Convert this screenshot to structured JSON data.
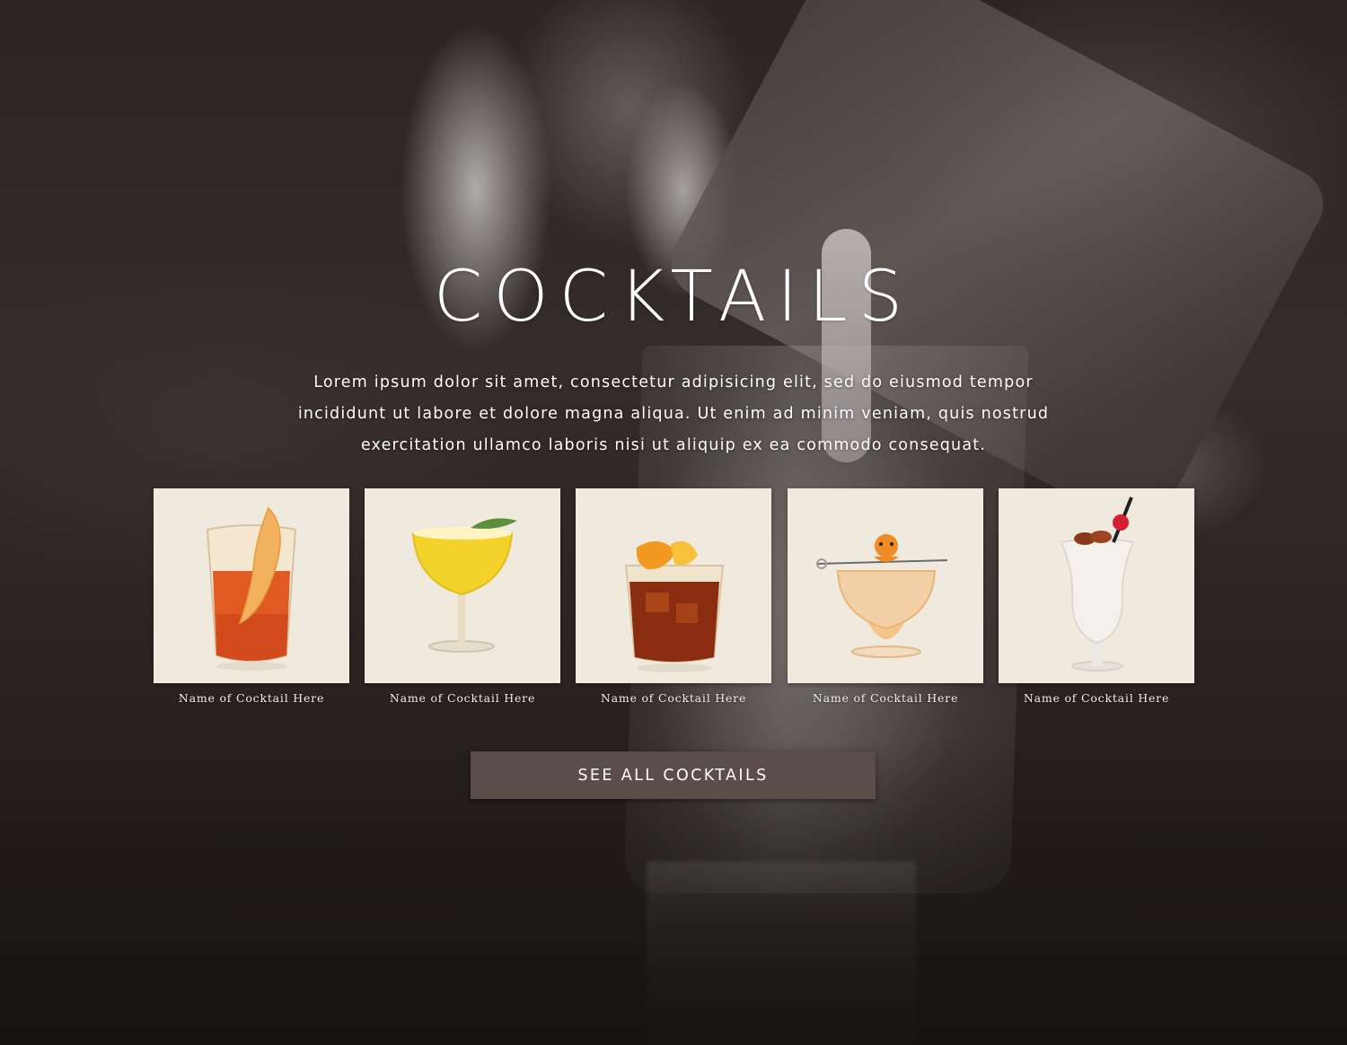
{
  "hero": {
    "title": "COCKTAILS",
    "intro": "Lorem ipsum dolor sit amet, consectetur adipisicing elit, sed do eiusmod tempor incididunt ut labore et dolore magna aliqua. Ut enim ad minim veniam, quis nostrud exercitation ullamco laboris nisi ut aliquip ex ea commodo consequat."
  },
  "cocktails": [
    {
      "name": "Name of Cocktail Here",
      "image": "orange-spritz-glass-icon"
    },
    {
      "name": "Name of Cocktail Here",
      "image": "yellow-coupe-glass-icon"
    },
    {
      "name": "Name of Cocktail Here",
      "image": "amber-rocks-glass-icon"
    },
    {
      "name": "Name of Cocktail Here",
      "image": "creamy-footed-glass-icon"
    },
    {
      "name": "Name of Cocktail Here",
      "image": "white-hurricane-glass-icon"
    }
  ],
  "cta": {
    "label": "SEE ALL COCKTAILS"
  },
  "colors": {
    "tile_background": "#f0eade",
    "button_background": "#5b4d4a",
    "text": "#ffffff"
  }
}
